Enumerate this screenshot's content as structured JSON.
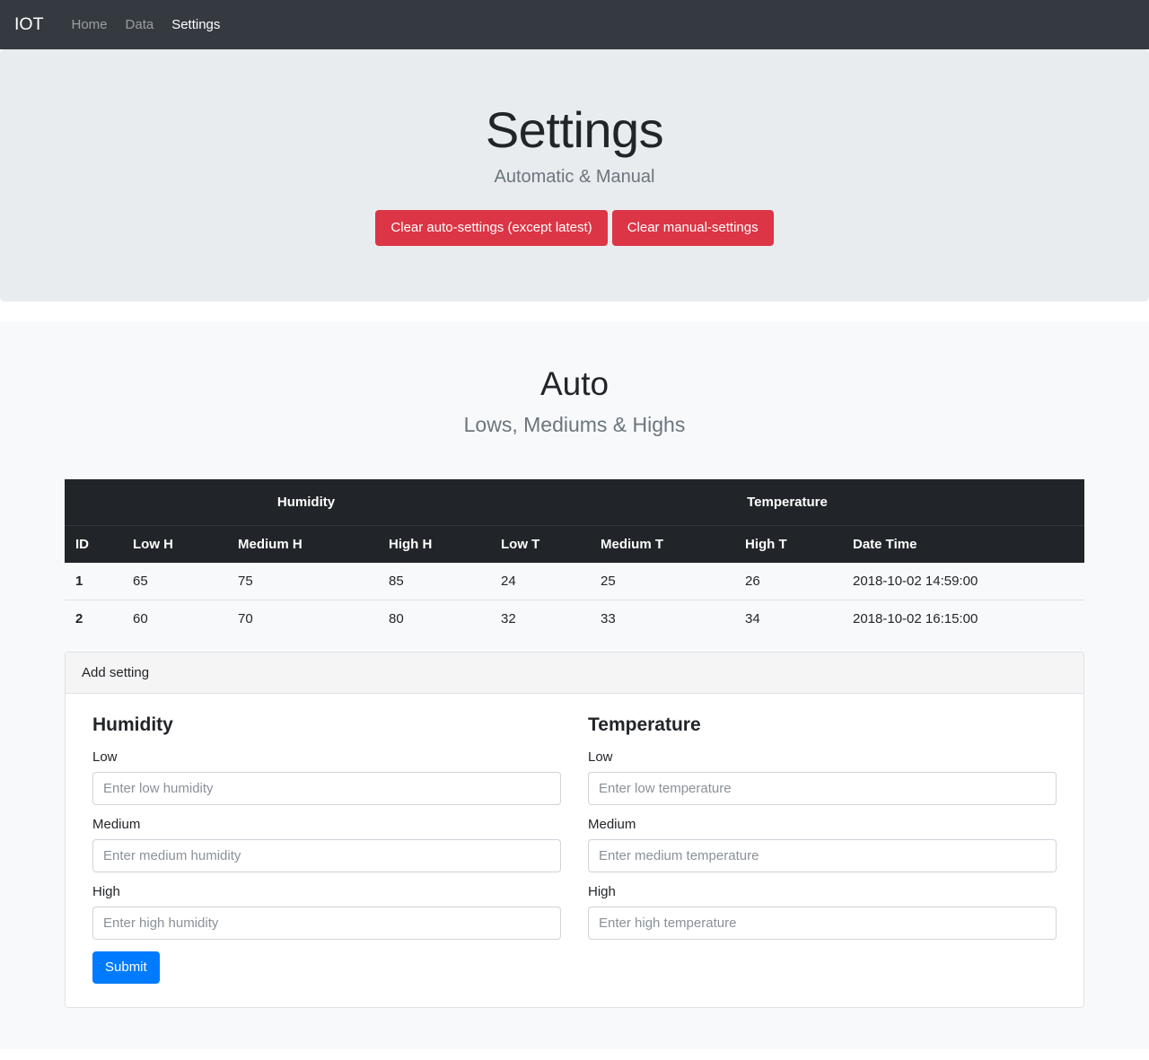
{
  "navbar": {
    "brand": "IOT",
    "links": [
      {
        "label": "Home",
        "active": false
      },
      {
        "label": "Data",
        "active": false
      },
      {
        "label": "Settings",
        "active": true
      }
    ]
  },
  "jumbotron": {
    "title": "Settings",
    "subtitle": "Automatic & Manual",
    "clear_auto_label": "Clear auto-settings (except latest)",
    "clear_manual_label": "Clear manual-settings"
  },
  "auto_section": {
    "title": "Auto",
    "subtitle": "Lows, Mediums & Highs",
    "table": {
      "group_headers": [
        {
          "label": "",
          "span": 1
        },
        {
          "label": "Humidity",
          "span": 3
        },
        {
          "label": "Temperature",
          "span": 4
        }
      ],
      "columns": [
        "ID",
        "Low H",
        "Medium H",
        "High H",
        "Low T",
        "Medium T",
        "High T",
        "Date Time"
      ],
      "rows": [
        {
          "id": "1",
          "low_h": "65",
          "medium_h": "75",
          "high_h": "85",
          "low_t": "24",
          "medium_t": "25",
          "high_t": "26",
          "datetime": "2018-10-02 14:59:00"
        },
        {
          "id": "2",
          "low_h": "60",
          "medium_h": "70",
          "high_h": "80",
          "low_t": "32",
          "medium_t": "33",
          "high_t": "34",
          "datetime": "2018-10-02 16:15:00"
        }
      ]
    },
    "card": {
      "header": "Add setting",
      "humidity": {
        "heading": "Humidity",
        "fields": [
          {
            "label": "Low",
            "placeholder": "Enter low humidity",
            "value": ""
          },
          {
            "label": "Medium",
            "placeholder": "Enter medium humidity",
            "value": ""
          },
          {
            "label": "High",
            "placeholder": "Enter high humidity",
            "value": ""
          }
        ]
      },
      "temperature": {
        "heading": "Temperature",
        "fields": [
          {
            "label": "Low",
            "placeholder": "Enter low temperature",
            "value": ""
          },
          {
            "label": "Medium",
            "placeholder": "Enter medium temperature",
            "value": ""
          },
          {
            "label": "High",
            "placeholder": "Enter high temperature",
            "value": ""
          }
        ]
      },
      "submit_label": "Submit"
    }
  },
  "colors": {
    "navbar_bg": "#343a40",
    "jumbotron_bg": "#e9ecef",
    "section_bg": "#f8f9fa",
    "table_header_bg": "#212529",
    "danger": "#dc3545",
    "primary": "#007bff",
    "muted_text": "#6c757d"
  }
}
